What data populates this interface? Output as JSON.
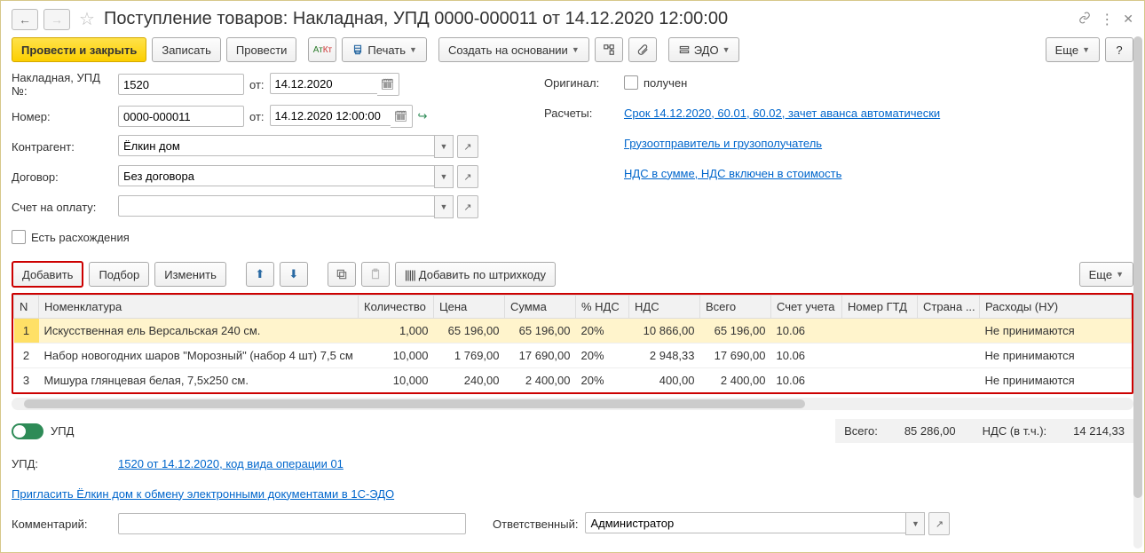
{
  "header": {
    "title": "Поступление товаров: Накладная, УПД 0000-000011 от 14.12.2020 12:00:00"
  },
  "toolbar": {
    "post_close": "Провести и закрыть",
    "write": "Записать",
    "post": "Провести",
    "print": "Печать",
    "create_based": "Создать на основании",
    "edo": "ЭДО",
    "more": "Еще",
    "help": "?"
  },
  "form": {
    "invoice_label": "Накладная, УПД №:",
    "invoice_no": "1520",
    "from": "от:",
    "invoice_date": "14.12.2020",
    "number_label": "Номер:",
    "number": "0000-000011",
    "number_date": "14.12.2020 12:00:00",
    "counterparty_label": "Контрагент:",
    "counterparty": "Ёлкин дом",
    "contract_label": "Договор:",
    "contract": "Без договора",
    "invoice_pay_label": "Счет на оплату:",
    "invoice_pay": "",
    "discrepancies": "Есть расхождения",
    "original_label": "Оригинал:",
    "original_received": "получен",
    "calc_label": "Расчеты:",
    "calc_link": "Срок 14.12.2020, 60.01, 60.02, зачет аванса автоматически",
    "shipper_link": "Грузоотправитель и грузополучатель",
    "vat_link": "НДС в сумме, НДС включен в стоимость"
  },
  "tbl_toolbar": {
    "add": "Добавить",
    "pick": "Подбор",
    "edit": "Изменить",
    "barcode": "Добавить по штрихкоду",
    "more": "Еще"
  },
  "columns": {
    "n": "N",
    "item": "Номенклатура",
    "qty": "Количество",
    "price": "Цена",
    "sum": "Сумма",
    "vat_pct": "% НДС",
    "vat": "НДС",
    "total": "Всего",
    "account": "Счет учета",
    "gtd": "Номер ГТД",
    "country": "Страна ...",
    "expenses": "Расходы (НУ)"
  },
  "rows": [
    {
      "n": "1",
      "item": "Искусственная ель Версальская 240 см.",
      "qty": "1,000",
      "price": "65 196,00",
      "sum": "65 196,00",
      "vat_pct": "20%",
      "vat": "10 866,00",
      "total": "65 196,00",
      "account": "10.06",
      "gtd": "",
      "country": "",
      "expenses": "Не принимаются"
    },
    {
      "n": "2",
      "item": "Набор новогодних шаров \"Морозный\" (набор 4 шт) 7,5 см",
      "qty": "10,000",
      "price": "1 769,00",
      "sum": "17 690,00",
      "vat_pct": "20%",
      "vat": "2 948,33",
      "total": "17 690,00",
      "account": "10.06",
      "gtd": "",
      "country": "",
      "expenses": "Не принимаются"
    },
    {
      "n": "3",
      "item": "Мишура глянцевая белая, 7,5х250 см.",
      "qty": "10,000",
      "price": "240,00",
      "sum": "2 400,00",
      "vat_pct": "20%",
      "vat": "400,00",
      "total": "2 400,00",
      "account": "10.06",
      "gtd": "",
      "country": "",
      "expenses": "Не принимаются"
    }
  ],
  "footer": {
    "upd_toggle": "УПД",
    "total_label": "Всего:",
    "total": "85 286,00",
    "vat_label": "НДС (в т.ч.):",
    "vat": "14 214,33",
    "upd_label": "УПД:",
    "upd_link": "1520 от 14.12.2020, код вида операции 01",
    "edo_invite": "Пригласить Ёлкин дом к обмену электронными документами в 1С-ЭДО",
    "comment_label": "Комментарий:",
    "comment": "",
    "responsible_label": "Ответственный:",
    "responsible": "Администратор"
  }
}
